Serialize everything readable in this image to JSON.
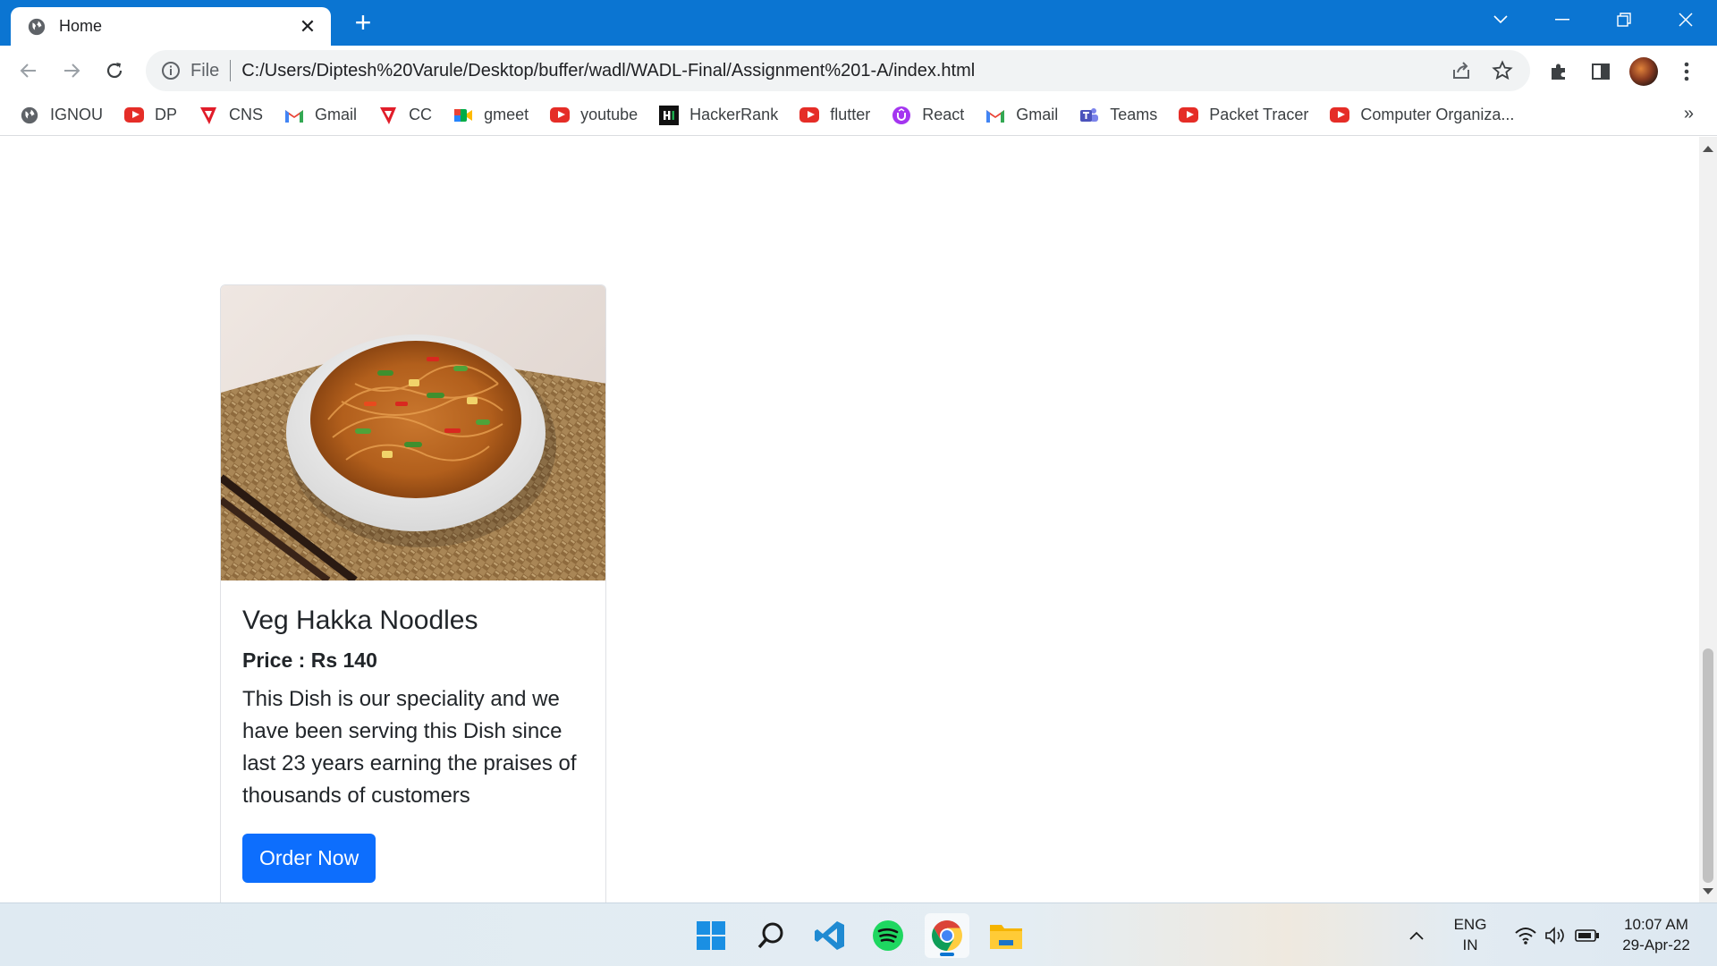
{
  "browser": {
    "tab_title": "Home",
    "address_label": "File",
    "url": "C:/Users/Diptesh%20Varule/Desktop/buffer/wadl/WADL-Final/Assignment%201-A/index.html"
  },
  "bookmarks": [
    {
      "label": "IGNOU",
      "icon": "globe-icon"
    },
    {
      "label": "DP",
      "icon": "youtube-icon"
    },
    {
      "label": "CNS",
      "icon": "tcs-icon"
    },
    {
      "label": "Gmail",
      "icon": "gmail-icon"
    },
    {
      "label": "CC",
      "icon": "tcs-icon"
    },
    {
      "label": "gmeet",
      "icon": "meet-icon"
    },
    {
      "label": "youtube",
      "icon": "youtube-icon"
    },
    {
      "label": "HackerRank",
      "icon": "hackerrank-icon"
    },
    {
      "label": "flutter",
      "icon": "youtube-icon"
    },
    {
      "label": "React",
      "icon": "udemy-icon"
    },
    {
      "label": "Gmail",
      "icon": "gmail-icon"
    },
    {
      "label": "Teams",
      "icon": "teams-icon"
    },
    {
      "label": "Packet Tracer",
      "icon": "youtube-icon"
    },
    {
      "label": "Computer Organiza...",
      "icon": "youtube-icon"
    }
  ],
  "bookmarks_overflow": "»",
  "card": {
    "title": "Veg Hakka Noodles",
    "price": "Price : Rs 140",
    "text": "This Dish is our speciality and we have been serving this Dish since last 23 years earning the praises of thousands of customers",
    "button": "Order Now"
  },
  "taskbar": {
    "lang_top": "ENG",
    "lang_bottom": "IN",
    "time": "10:07 AM",
    "date": "29-Apr-22"
  },
  "colors": {
    "chrome_blue": "#0b75d2",
    "button_blue": "#0d6efd"
  }
}
